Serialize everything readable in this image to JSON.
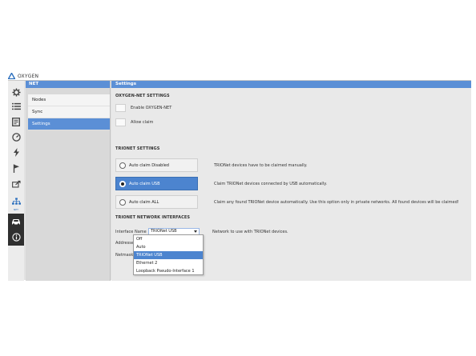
{
  "app": {
    "name": "OXYGEN"
  },
  "icon_bar": {
    "icons": [
      {
        "name": "gear-icon"
      },
      {
        "name": "list-icon"
      },
      {
        "name": "report-icon"
      },
      {
        "name": "gauge-icon"
      },
      {
        "name": "lightning-icon"
      },
      {
        "name": "flag-icon"
      },
      {
        "name": "export-icon"
      },
      {
        "name": "network-icon",
        "label": "NET"
      },
      {
        "name": "car-icon"
      },
      {
        "name": "info-icon"
      }
    ]
  },
  "nav_panel": {
    "title": "NET",
    "items": [
      {
        "label": "Nodes",
        "selected": false
      },
      {
        "label": "Sync",
        "selected": false
      },
      {
        "label": "Settings",
        "selected": true
      }
    ]
  },
  "settings": {
    "title": "Settings",
    "oxygen_net": {
      "title": "OXYGEN-NET SETTINGS",
      "enable_label": "Enable OXYGEN-NET",
      "allow_claim_label": "Allow claim"
    },
    "trionet": {
      "title": "TRIONET SETTINGS",
      "options": [
        {
          "label": "Auto claim Disabled",
          "description": "TRIONet devices have to be claimed manually.",
          "selected": false
        },
        {
          "label": "Auto claim USB",
          "description": "Claim TRIONet devices connected by USB automatically.",
          "selected": true
        },
        {
          "label": "Auto claim ALL",
          "description": "Claim any found TRIONet device automatically. Use this option only in private networks. All found devices will be claimed!",
          "selected": false
        }
      ]
    },
    "interfaces": {
      "title": "TRIONET NETWORK INTERFACES",
      "interface_name_label": "Interface Name",
      "interface_value": "TRIONet USB",
      "interface_description": "Network to use with TRIONet devices.",
      "addresses_label": "Addresses",
      "netmasks_label": "Netmasks",
      "dropdown_options": [
        {
          "label": "Off",
          "selected": false
        },
        {
          "label": "Auto",
          "selected": false
        },
        {
          "label": "TRIONet USB",
          "selected": true
        },
        {
          "label": "Ethernet 2",
          "selected": false
        },
        {
          "label": "Loopback Pseudo-Interface 1",
          "selected": false
        }
      ]
    }
  },
  "colors": {
    "accent": "#5b8fd6",
    "selected_blue": "#4c84cf",
    "panel_bg": "#e2e2e2"
  }
}
